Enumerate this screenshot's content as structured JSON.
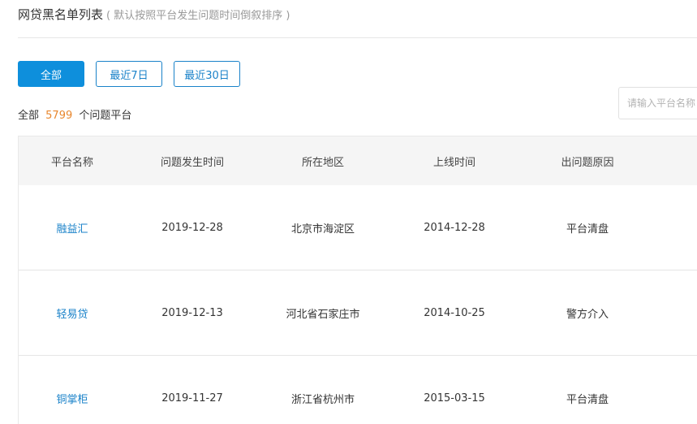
{
  "header": {
    "title": "网贷黑名单列表",
    "subtitle": "( 默认按照平台发生问题时间倒叙排序 )"
  },
  "filters": [
    {
      "label": "全部",
      "active": true
    },
    {
      "label": "最近7日",
      "active": false
    },
    {
      "label": "最近30日",
      "active": false
    }
  ],
  "summary": {
    "prefix": "全部",
    "count": "5799",
    "suffix": "个问题平台"
  },
  "search": {
    "placeholder": "请输入平台名称"
  },
  "table": {
    "columns": [
      "平台名称",
      "问题发生时间",
      "所在地区",
      "上线时间",
      "出问题原因"
    ],
    "rows": [
      {
        "name": "融益汇",
        "issue_date": "2019-12-28",
        "region": "北京市海淀区",
        "online_date": "2014-12-28",
        "reason": "平台清盘"
      },
      {
        "name": "轻易贷",
        "issue_date": "2019-12-13",
        "region": "河北省石家庄市",
        "online_date": "2014-10-25",
        "reason": "警方介入"
      },
      {
        "name": "铜掌柜",
        "issue_date": "2019-11-27",
        "region": "浙江省杭州市",
        "online_date": "2015-03-15",
        "reason": "平台清盘"
      }
    ]
  },
  "colors": {
    "accent": "#0e8fdc",
    "link": "#1a82c9",
    "count": "#e8872e"
  }
}
